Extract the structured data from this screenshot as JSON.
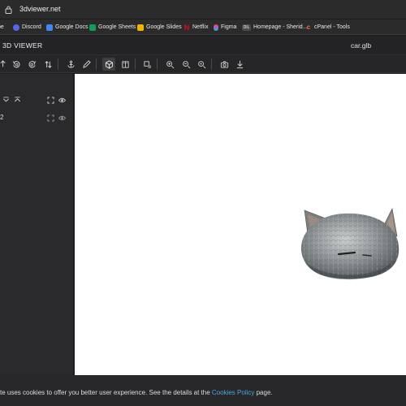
{
  "browser": {
    "url": "3dviewer.net",
    "bookmarks": [
      {
        "label": "be",
        "icon": "youtube-icon",
        "color": "#ff3b30"
      },
      {
        "label": "Discord",
        "icon": "discord-icon",
        "color": "#5865f2"
      },
      {
        "label": "Google Docs",
        "icon": "google-docs-icon",
        "color": "#4285f4"
      },
      {
        "label": "Google Sheets",
        "icon": "google-sheets-icon",
        "color": "#0f9d58"
      },
      {
        "label": "Google Slides",
        "icon": "google-slides-icon",
        "color": "#f4b400"
      },
      {
        "label": "Netflix",
        "icon": "netflix-icon",
        "color": "#e50914"
      },
      {
        "label": "Figma",
        "icon": "figma-icon",
        "color": "#a259ff"
      },
      {
        "label": "Homepage - Sherid...",
        "icon": "sheridan-icon",
        "color": "#5a5a5a"
      },
      {
        "label": "cPanel - Tools",
        "icon": "cpanel-icon",
        "color": "#ff6c2c"
      }
    ]
  },
  "app": {
    "title": "3D VIEWER",
    "file_name": "car.glb"
  },
  "toolbar": {
    "buttons": [
      {
        "name": "open-file-button",
        "icon": "open-file-icon"
      },
      {
        "name": "rotate-left-button",
        "icon": "rotate-left-icon"
      },
      {
        "name": "rotate-right-button",
        "icon": "rotate-right-icon"
      },
      {
        "name": "flip-up-vector-button",
        "icon": "flip-icon"
      },
      {
        "name": "fix-up-vector-button",
        "icon": "anchor-icon"
      },
      {
        "name": "edit-button",
        "icon": "pencil-icon",
        "active": true
      },
      {
        "name": "perspective-button",
        "icon": "cube-icon",
        "active": true
      },
      {
        "name": "orthographic-button",
        "icon": "book-icon"
      },
      {
        "name": "fit-to-window-button",
        "icon": "fit-icon"
      },
      {
        "name": "measure-button",
        "icon": "measure-icon"
      },
      {
        "name": "measure-point-button",
        "icon": "measure-point-icon"
      },
      {
        "name": "measure-settings-button",
        "icon": "measure-settings-icon"
      },
      {
        "name": "snapshot-button",
        "icon": "camera-icon"
      },
      {
        "name": "export-button",
        "icon": "download-icon"
      }
    ]
  },
  "sidebar": {
    "tree": {
      "root_icons": [
        "collapse-all-icon",
        "expand-all-icon",
        "fit-icon",
        "eye-icon"
      ],
      "items": [
        {
          "label": "2",
          "icons": [
            "fit-icon",
            "eye-icon"
          ]
        }
      ]
    }
  },
  "cookie": {
    "text_before": "te uses cookies to offer you better user experience. See the details at the ",
    "link": "Cookies Policy",
    "text_after": " page."
  },
  "colors": {
    "app_bg": "#1f1f20",
    "viewport_bg": "#ffffff",
    "link": "#4ea3e0",
    "model_fur": "#8e9496"
  }
}
